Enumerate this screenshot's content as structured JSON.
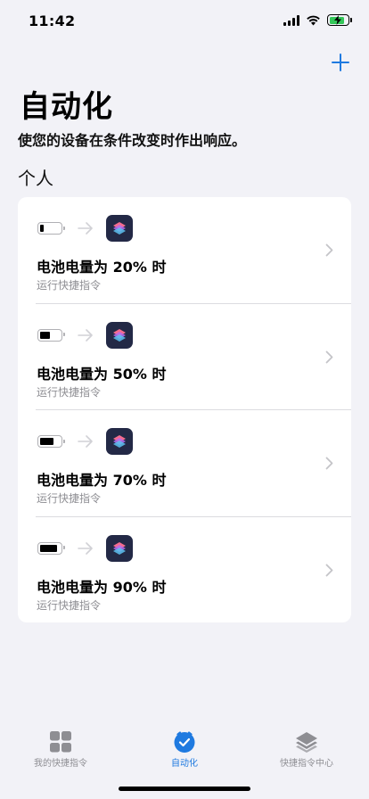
{
  "status_bar": {
    "time": "11:42",
    "icons": [
      "signal-icon",
      "wifi-icon",
      "battery-charging-icon"
    ]
  },
  "header": {
    "add_icon": "plus-icon",
    "title": "自动化",
    "subtitle": "使您的设备在条件改变时作出响应。"
  },
  "section": {
    "title": "个人"
  },
  "automations": [
    {
      "title": "电池电量为 20% 时",
      "subtitle": "运行快捷指令",
      "battery_level": 0.2
    },
    {
      "title": "电池电量为 50% 时",
      "subtitle": "运行快捷指令",
      "battery_level": 0.5
    },
    {
      "title": "电池电量为 70% 时",
      "subtitle": "运行快捷指令",
      "battery_level": 0.7
    },
    {
      "title": "电池电量为 90% 时",
      "subtitle": "运行快捷指令",
      "battery_level": 0.9
    }
  ],
  "tab_bar": {
    "tabs": [
      {
        "label": "我的快捷指令",
        "icon": "grid-icon",
        "active": false
      },
      {
        "label": "自动化",
        "icon": "checkmark-clock-icon",
        "active": true
      },
      {
        "label": "快捷指令中心",
        "icon": "layers-icon",
        "active": false
      }
    ]
  },
  "colors": {
    "accent": "#1f7ae0",
    "background": "#f2f2f7",
    "shortcut_icon_bg": "#232946"
  }
}
